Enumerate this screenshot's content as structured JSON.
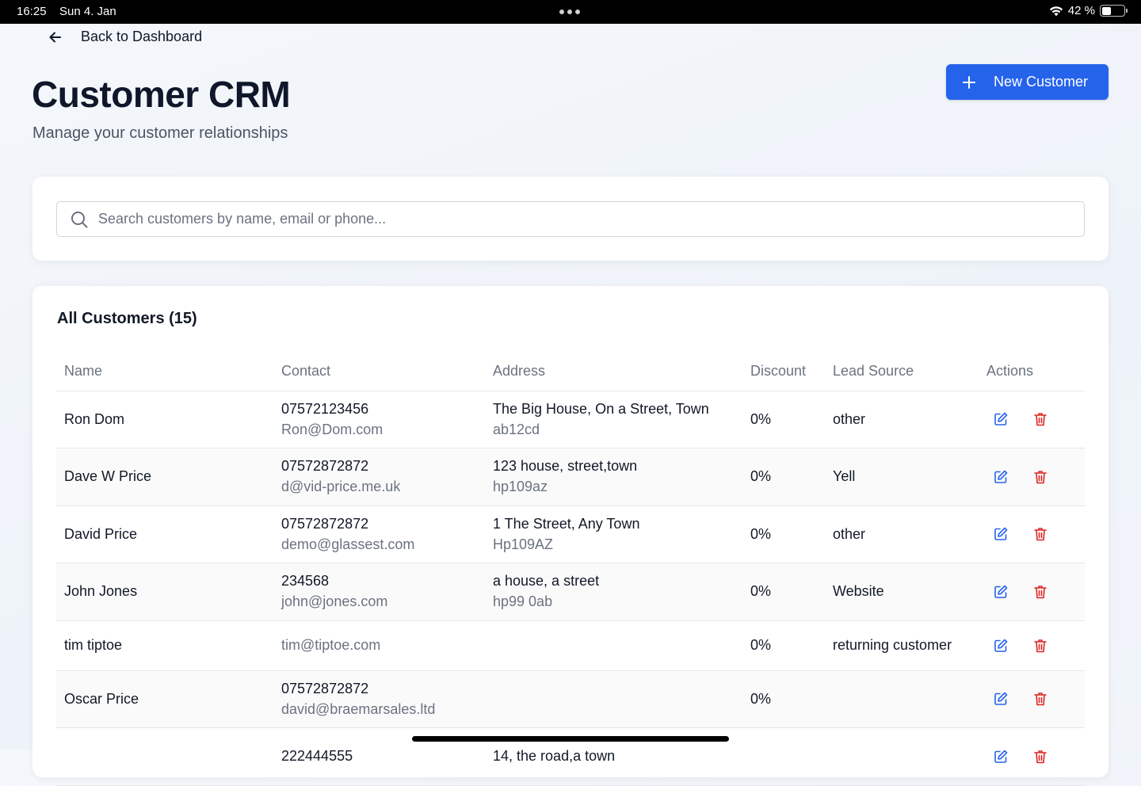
{
  "statusbar": {
    "time": "16:25",
    "date": "Sun 4. Jan",
    "battery": "42 %"
  },
  "nav": {
    "back_label": "Back to Dashboard"
  },
  "header": {
    "title": "Customer CRM",
    "subtitle": "Manage your customer relationships",
    "new_button": "New Customer"
  },
  "search": {
    "placeholder": "Search customers by name, email or phone...",
    "value": ""
  },
  "table": {
    "title": "All Customers (15)",
    "columns": [
      "Name",
      "Contact",
      "Address",
      "Discount",
      "Lead Source",
      "Actions"
    ],
    "rows": [
      {
        "name": "Ron Dom",
        "phone": "07572123456",
        "email": "Ron@Dom.com",
        "address": "The Big House, On a Street, Town",
        "postcode": "ab12cd",
        "discount": "0%",
        "lead": "other"
      },
      {
        "name": "Dave W Price",
        "phone": "07572872872",
        "email": "d@vid-price.me.uk",
        "address": "123 house, street,town",
        "postcode": "hp109az",
        "discount": "0%",
        "lead": "Yell"
      },
      {
        "name": "David Price",
        "phone": "07572872872",
        "email": "demo@glassest.com",
        "address": "1 The Street, Any Town",
        "postcode": "Hp109AZ",
        "discount": "0%",
        "lead": "other"
      },
      {
        "name": "John Jones",
        "phone": "234568",
        "email": "john@jones.com",
        "address": "a house, a street",
        "postcode": "hp99 0ab",
        "discount": "0%",
        "lead": "Website"
      },
      {
        "name": "tim tiptoe",
        "phone": "",
        "email": "tim@tiptoe.com",
        "address": "",
        "postcode": "",
        "discount": "0%",
        "lead": "returning customer"
      },
      {
        "name": "Oscar Price",
        "phone": "07572872872",
        "email": "david@braemarsales.ltd",
        "address": "",
        "postcode": "",
        "discount": "0%",
        "lead": ""
      },
      {
        "name": "",
        "phone": "222444555",
        "email": "",
        "address": "14, the road,a town",
        "postcode": "",
        "discount": "",
        "lead": ""
      }
    ]
  },
  "colors": {
    "primary": "#2563eb",
    "danger": "#dc2626",
    "edit": "#2563eb"
  },
  "icons": [
    "arrow-left-icon",
    "plus-icon",
    "search-icon",
    "edit-icon",
    "trash-icon"
  ]
}
